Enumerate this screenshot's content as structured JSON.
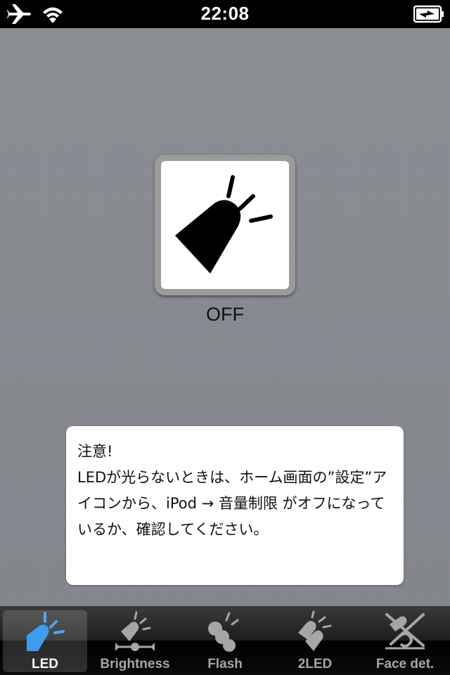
{
  "status_bar": {
    "time": "22:08",
    "icons": [
      "airplane-icon",
      "wifi-icon",
      "battery-charging-icon"
    ]
  },
  "main": {
    "toggle_icon": "led-light-icon",
    "state_label": "OFF",
    "notice": {
      "title": "注意!",
      "body": "LEDが光らないときは、ホーム画面の”設定”アイコンから、iPod → 音量制限 がオフになっているか、確認してください。"
    }
  },
  "tabs": [
    {
      "label": "LED",
      "icon": "led-icon",
      "selected": true
    },
    {
      "label": "Brightness",
      "icon": "brightness-icon",
      "selected": false
    },
    {
      "label": "Flash",
      "icon": "flash-icon",
      "selected": false
    },
    {
      "label": "2LED",
      "icon": "two-led-icon",
      "selected": false
    },
    {
      "label": "Face det.",
      "icon": "face-detection-icon",
      "selected": false
    }
  ],
  "colors": {
    "tab_selected_icon": "#3d9bf0",
    "tab_inactive": "#a6a6a6",
    "background": "#878a90"
  }
}
